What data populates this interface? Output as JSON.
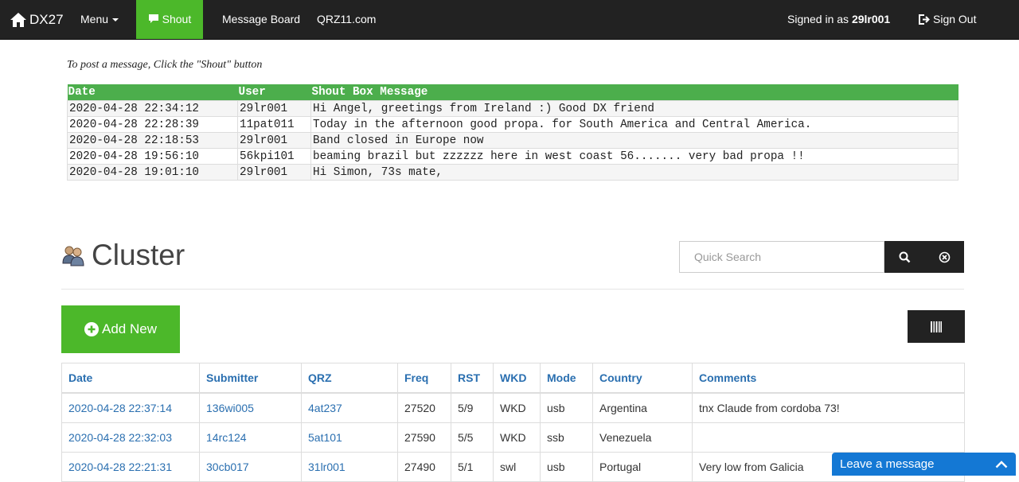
{
  "nav": {
    "brand": "DX27",
    "menu": "Menu",
    "shout": "Shout",
    "message_board": "Message Board",
    "qrz": "QRZ11.com",
    "signed_in_prefix": "Signed in as ",
    "username": "29lr001",
    "sign_out": "Sign Out"
  },
  "hint": "To post a message, Click the \"Shout\" button",
  "shoutbox": {
    "headers": [
      "Date",
      "User",
      "Shout Box Message"
    ],
    "rows": [
      [
        "2020-04-28 22:34:12",
        "29lr001",
        "Hi Angel, greetings from Ireland :) Good DX friend"
      ],
      [
        "2020-04-28 22:28:39",
        "11pat011",
        "Today in the afternoon good propa. for South America and Central America."
      ],
      [
        "2020-04-28 22:18:53",
        "29lr001",
        "Band closed in Europe now"
      ],
      [
        "2020-04-28 19:56:10",
        "56kpi101",
        "beaming brazil but zzzzzz here in west coast 56....... very bad propa !!"
      ],
      [
        "2020-04-28 19:01:10",
        "29lr001",
        "Hi Simon, 73s mate,"
      ]
    ]
  },
  "cluster": {
    "title": "Cluster",
    "search_placeholder": "Quick Search",
    "add_new": "Add New",
    "headers": [
      "Date",
      "Submitter",
      "QRZ",
      "Freq",
      "RST",
      "WKD",
      "Mode",
      "Country",
      "Comments"
    ],
    "rows": [
      [
        "2020-04-28 22:37:14",
        "136wi005",
        "4at237",
        "27520",
        "5/9",
        "WKD",
        "usb",
        "Argentina",
        "tnx Claude from cordoba 73!"
      ],
      [
        "2020-04-28 22:32:03",
        "14rc124",
        "5at101",
        "27590",
        "5/5",
        "WKD",
        "ssb",
        "Venezuela",
        ""
      ],
      [
        "2020-04-28 22:21:31",
        "30cb017",
        "31lr001",
        "27490",
        "5/1",
        "swl",
        "usb",
        "Portugal",
        "Very low from Galicia"
      ]
    ]
  },
  "chat": {
    "label": "Leave a message"
  },
  "colors": {
    "nav_bg": "#222222",
    "green": "#4cb82a",
    "link": "#2a6fb0",
    "chat": "#1478d4"
  }
}
